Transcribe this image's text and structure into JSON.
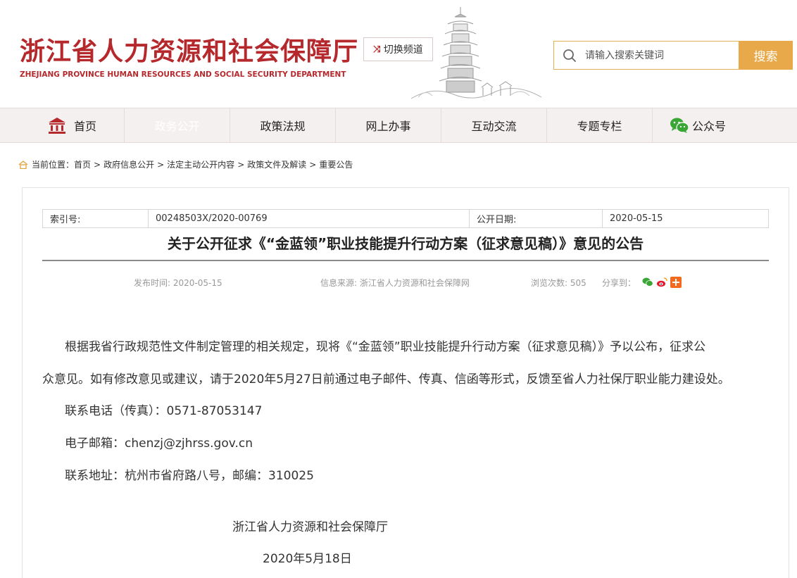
{
  "header": {
    "title_cn": "浙江省人力资源和社会保障厅",
    "title_en": "ZHEJIANG PROVINCE HUMAN RESOURCES AND SOCIAL SECURITY DEPARTMENT",
    "switch_label": "切换频道",
    "search_placeholder": "请输入搜索关键词",
    "search_button": "搜索"
  },
  "nav": {
    "items": [
      {
        "label": "首页",
        "icon": "building-icon"
      },
      {
        "label": "政务公开"
      },
      {
        "label": "政策法规"
      },
      {
        "label": "网上办事"
      },
      {
        "label": "互动交流"
      },
      {
        "label": "专题专栏"
      },
      {
        "label": "公众号",
        "icon": "wechat-icon"
      }
    ]
  },
  "breadcrumb": {
    "prefix": "当前位置：",
    "items": [
      "首页",
      "政府信息公开",
      "法定主动公开内容",
      "政策文件及解读",
      "重要公告"
    ],
    "separator": ">"
  },
  "meta": {
    "index_label": "索引号:",
    "index_value": "00248503X/2020-00769",
    "date_label": "公开日期:",
    "date_value": "2020-05-15"
  },
  "article": {
    "title": "关于公开征求《“金蓝领”职业技能提升行动方案（征求意见稿）》意见的公告",
    "publish_time": "发布时间: 2020-05-15",
    "source": "信息来源: 浙江省人力资源和社会保障网",
    "views": "浏览次数: 505",
    "share_label": "分享到：",
    "paragraph_line1": "根据我省行政规范性文件制定管理的相关规定，现将《“金蓝领”职业技能提升行动方案（征求意见稿）》予以公布，征求公",
    "paragraph_line2": "众意见。如有修改意见或建议，请于2020年5月27日前通过电子邮件、传真、信函等形式，反馈至省人力社保厅职业能力建设处。",
    "phone": "联系电话（传真）：0571-87053147",
    "email": "电子邮箱：chenzj@zjhrss.gov.cn",
    "address": "联系地址：杭州市省府路八号，邮编：310025",
    "signature": "浙江省人力资源和社会保障厅",
    "sign_date": "2020年5月18日"
  },
  "colors": {
    "brand_red": "#b5282c",
    "search_orange": "#e8a94a"
  }
}
